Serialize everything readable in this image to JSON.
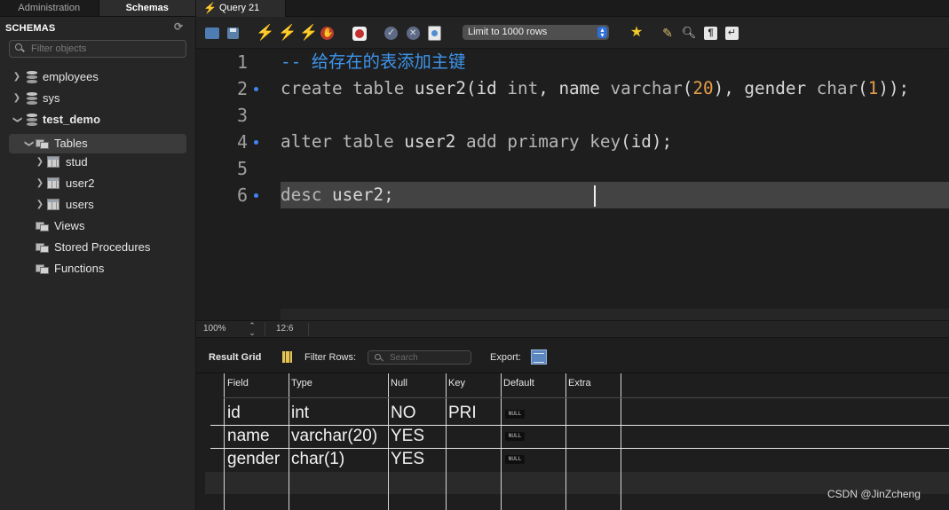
{
  "sidebar": {
    "tabs": [
      "Administration",
      "Schemas"
    ],
    "section_title": "SCHEMAS",
    "filter_placeholder": "Filter objects",
    "schemas": [
      {
        "name": "employees",
        "expanded": false
      },
      {
        "name": "sys",
        "expanded": false
      },
      {
        "name": "test_demo",
        "expanded": true
      }
    ],
    "tables_label": "Tables",
    "tables": [
      "stud",
      "user2",
      "users"
    ],
    "views_label": "Views",
    "procedures_label": "Stored Procedures",
    "functions_label": "Functions"
  },
  "query_tab": {
    "label": "Query 21"
  },
  "toolbar": {
    "limit_value": "Limit to 1000 rows",
    "icons": [
      "open-folder-icon",
      "save-icon",
      "execute-icon",
      "execute-current-icon",
      "explain-icon",
      "stop-icon",
      "toggle-error-icon",
      "commit-icon",
      "rollback-icon",
      "autocommit-icon",
      "beautify-icon",
      "brush-icon",
      "find-icon",
      "invisibles-icon",
      "wrap-icon"
    ]
  },
  "editor": {
    "lines": [
      {
        "num": "1",
        "marker": false
      },
      {
        "num": "2",
        "marker": true
      },
      {
        "num": "3",
        "marker": false
      },
      {
        "num": "4",
        "marker": true
      },
      {
        "num": "5",
        "marker": false
      },
      {
        "num": "6",
        "marker": true
      }
    ],
    "comment": "-- 给存在的表添加主键",
    "line2": {
      "kw1": "create table",
      "t1": " user2(id ",
      "kw2": "int",
      "t2": ", name ",
      "kw3": "varchar",
      "t3": "(",
      "n1": "20",
      "t4": "), gender ",
      "kw4": "char",
      "t5": "(",
      "n2": "1",
      "t6": "));"
    },
    "line4": {
      "kw1": "alter table",
      "t1": " user2 ",
      "kw2": "add primary key",
      "t2": "(id);"
    },
    "line6": {
      "kw1": "desc",
      "t1": " user2;"
    }
  },
  "status": {
    "zoom": "100%",
    "cursor": "12:6"
  },
  "result_bar": {
    "grid_label": "Result Grid",
    "filter_label": "Filter Rows:",
    "search_placeholder": "Search",
    "export_label": "Export:"
  },
  "grid": {
    "columns": [
      "Field",
      "Type",
      "Null",
      "Key",
      "Default",
      "Extra"
    ],
    "rows": [
      {
        "field": "id",
        "type": "int",
        "null": "NO",
        "key": "PRI",
        "default": "NULL",
        "extra": ""
      },
      {
        "field": "name",
        "type": "varchar(20)",
        "null": "YES",
        "key": "",
        "default": "NULL",
        "extra": ""
      },
      {
        "field": "gender",
        "type": "char(1)",
        "null": "YES",
        "key": "",
        "default": "NULL",
        "extra": ""
      }
    ]
  },
  "watermark": "CSDN @JinZcheng",
  "colors": {
    "comment": "#3e95ec",
    "number": "#e39d4a",
    "line_marker": "#3f86f2",
    "current_line": "#434343"
  }
}
